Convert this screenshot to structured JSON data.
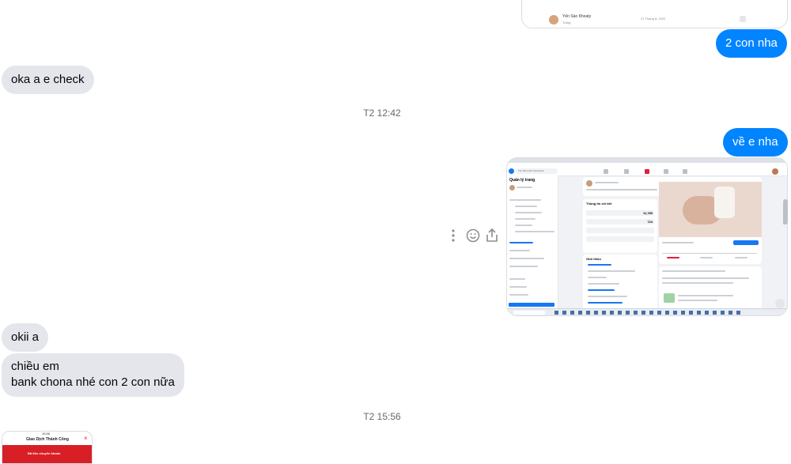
{
  "messages": {
    "m1": "2 con nha",
    "m2": "oka a e check",
    "m3": "về e nha",
    "m4": "okii a",
    "m5_line1": "chiều em",
    "m5_line2": "bank chona nhé con 2 con nữa"
  },
  "timestamps": {
    "t1": "T2 12:42",
    "t2": "T2 15:56"
  },
  "top_image": {
    "row_name": "Yến Sào Khoaty",
    "row_sub": "Trang",
    "row_date": "27 Tháng 8, 2022"
  },
  "screenshot_image": {
    "title": "Quản lý trang",
    "panel_title": "Thông tin chi tiết",
    "value": "11,789",
    "value2": "724",
    "section": "Giới thiệu",
    "search": "Tìm kiếm trên Facebook"
  },
  "receipt_image": {
    "title": "Giao Dịch Thành Công",
    "sub": "Đã tiền chuyển khoản",
    "time": "15:56"
  },
  "icons": [
    "more-icon",
    "emoji-icon",
    "share-icon"
  ]
}
